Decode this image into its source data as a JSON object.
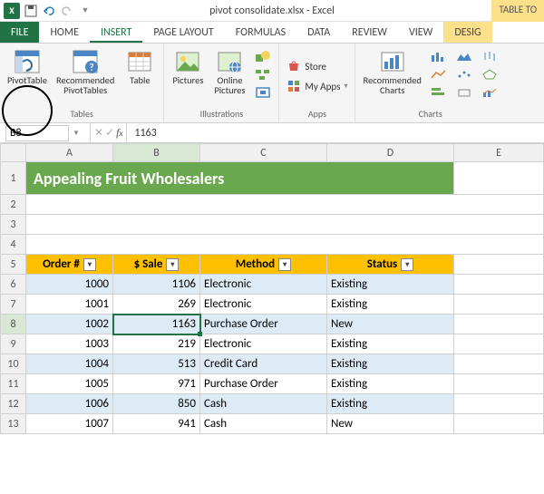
{
  "titlebar": {
    "title": "pivot consolidate.xlsx - Excel",
    "context_tab": "TABLE TO"
  },
  "tabs": {
    "file": "FILE",
    "home": "HOME",
    "insert": "INSERT",
    "page_layout": "PAGE LAYOUT",
    "formulas": "FORMULAS",
    "data": "DATA",
    "review": "REVIEW",
    "view": "VIEW",
    "design": "DESIG"
  },
  "ribbon": {
    "tables_label": "Tables",
    "pivot_table": "PivotTable",
    "rec_pivot": "Recommended\nPivotTables",
    "table": "Table",
    "illustrations_label": "Illustrations",
    "pictures": "Pictures",
    "online_pics": "Online\nPictures",
    "apps_label": "Apps",
    "store": "Store",
    "myapps": "My Apps",
    "charts_label": "Charts",
    "rec_charts": "Recommended\nCharts"
  },
  "fxbar": {
    "namebox": "B8",
    "formula": "1163"
  },
  "cols": {
    "A": "A",
    "B": "B",
    "C": "C",
    "D": "D",
    "E": "E"
  },
  "rows": {
    "r1": "1",
    "r2": "2",
    "r3": "3",
    "r4": "4",
    "r5": "5",
    "r6": "6",
    "r7": "7",
    "r8": "8",
    "r9": "9",
    "r10": "10",
    "r11": "11",
    "r12": "12",
    "r13": "13"
  },
  "sheet": {
    "banner": "Appealing Fruit Wholesalers",
    "headers": {
      "order": "Order #",
      "sale": "$ Sale",
      "method": "Method",
      "status": "Status"
    },
    "data": [
      {
        "order": "1000",
        "sale": "1106",
        "method": "Electronic",
        "status": "Existing"
      },
      {
        "order": "1001",
        "sale": "269",
        "method": "Electronic",
        "status": "Existing"
      },
      {
        "order": "1002",
        "sale": "1163",
        "method": "Purchase Order",
        "status": "New"
      },
      {
        "order": "1003",
        "sale": "219",
        "method": "Electronic",
        "status": "Existing"
      },
      {
        "order": "1004",
        "sale": "513",
        "method": "Credit Card",
        "status": "Existing"
      },
      {
        "order": "1005",
        "sale": "971",
        "method": "Purchase Order",
        "status": "Existing"
      },
      {
        "order": "1006",
        "sale": "850",
        "method": "Cash",
        "status": "Existing"
      },
      {
        "order": "1007",
        "sale": "941",
        "method": "Cash",
        "status": "New"
      }
    ]
  }
}
